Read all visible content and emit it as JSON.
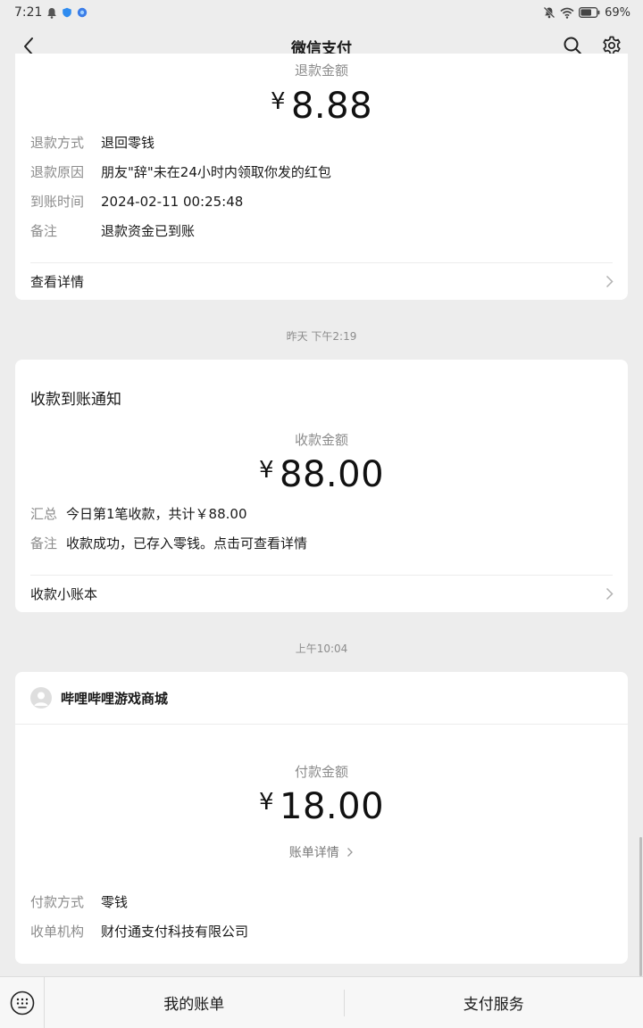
{
  "status_bar": {
    "time": "7:21",
    "battery": "69%"
  },
  "nav": {
    "title": "微信支付"
  },
  "card1": {
    "label_partial": "退款金额",
    "currency": "¥",
    "amount": "8.88",
    "rows": [
      {
        "key": "退款方式",
        "value": "退回零钱"
      },
      {
        "key": "退款原因",
        "value": "朋友\"辞\"未在24小时内领取你发的红包"
      },
      {
        "key": "到账时间",
        "value": "2024-02-11 00:25:48"
      },
      {
        "key": "备注",
        "value": "退款资金已到账"
      }
    ],
    "link": "查看详情"
  },
  "timestamp1": "昨天 下午2:19",
  "card2": {
    "title": "收款到账通知",
    "amount_label": "收款金额",
    "currency": "¥",
    "amount": "88.00",
    "rows": [
      {
        "key": "汇总",
        "value": "今日第1笔收款，共计￥88.00"
      },
      {
        "key": "备注",
        "value": "收款成功，已存入零钱。点击可查看详情"
      }
    ],
    "link": "收款小账本"
  },
  "timestamp2": "上午10:04",
  "card3": {
    "merchant": "哔哩哔哩游戏商城",
    "amount_label": "付款金额",
    "currency": "¥",
    "amount": "18.00",
    "bill_detail": "账单详情",
    "rows": [
      {
        "key": "付款方式",
        "value": "零钱"
      },
      {
        "key": "收单机构",
        "value": "财付通支付科技有限公司"
      }
    ]
  },
  "bottom_bar": {
    "tab1": "我的账单",
    "tab2": "支付服务"
  }
}
